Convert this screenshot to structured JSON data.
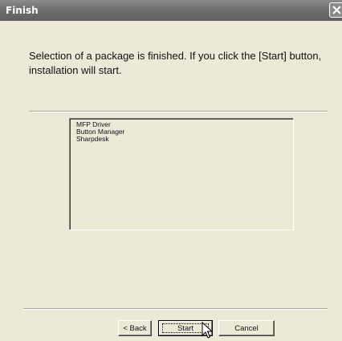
{
  "window": {
    "title": "Finish"
  },
  "message": "Selection of a package is finished. If you click the [Start] button, installation will start.",
  "packages": {
    "items": [
      "MFP Driver",
      "Button Manager",
      "Sharpdesk"
    ]
  },
  "buttons": {
    "back_label": "< Back",
    "start_label": "Start",
    "cancel_label": "Cancel"
  },
  "icons": {
    "close": "close-icon",
    "cursor": "mouse-pointer-icon"
  },
  "colors": {
    "titlebar": "#6f6f6f",
    "dialog_bg": "#ece9d8"
  }
}
